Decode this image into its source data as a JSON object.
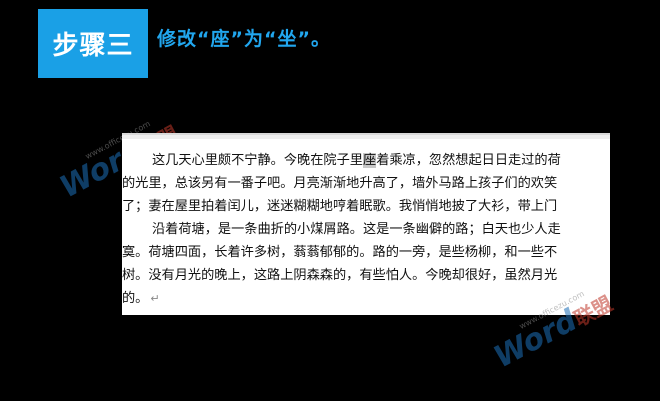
{
  "step": {
    "badge": "步骤三",
    "instruction": "修改“座”为“坐”。"
  },
  "watermark": {
    "url": "www.officezu.com",
    "brand_en": "Word",
    "brand_cn": "联盟"
  },
  "document": {
    "lines": [
      {
        "pre": "这几天心里颇不宁静。今晚在院子里",
        "hl": "座",
        "post": "着乘凉，忽然想起日日走过的荷"
      },
      {
        "pre": "的光里，总该另有一番子吧。月亮渐渐地升高了，墙外马路上孩子们的欢笑"
      },
      {
        "pre": "了；妻在屋里拍着闰儿，迷迷糊糊地哼着眠歌。我悄悄地披了大衫，带上门"
      },
      {
        "pre": "沿着荷塘，是一条曲折的小煤屑路。这是一条幽僻的路；白天也少人走"
      },
      {
        "pre": "寞。荷塘四面，长着许多树，蓊蓊郁郁的。路的一旁，是些杨柳，和一些不"
      },
      {
        "pre": "树。没有月光的晚上，这路上阴森森的，有些怕人。今晚却很好，虽然月光"
      },
      {
        "pre": "的。",
        "mark": "↵"
      }
    ]
  },
  "colors": {
    "badge_bg": "#1aa0e6",
    "instruction": "#21a6ee",
    "highlight": "#c8c8c8"
  }
}
